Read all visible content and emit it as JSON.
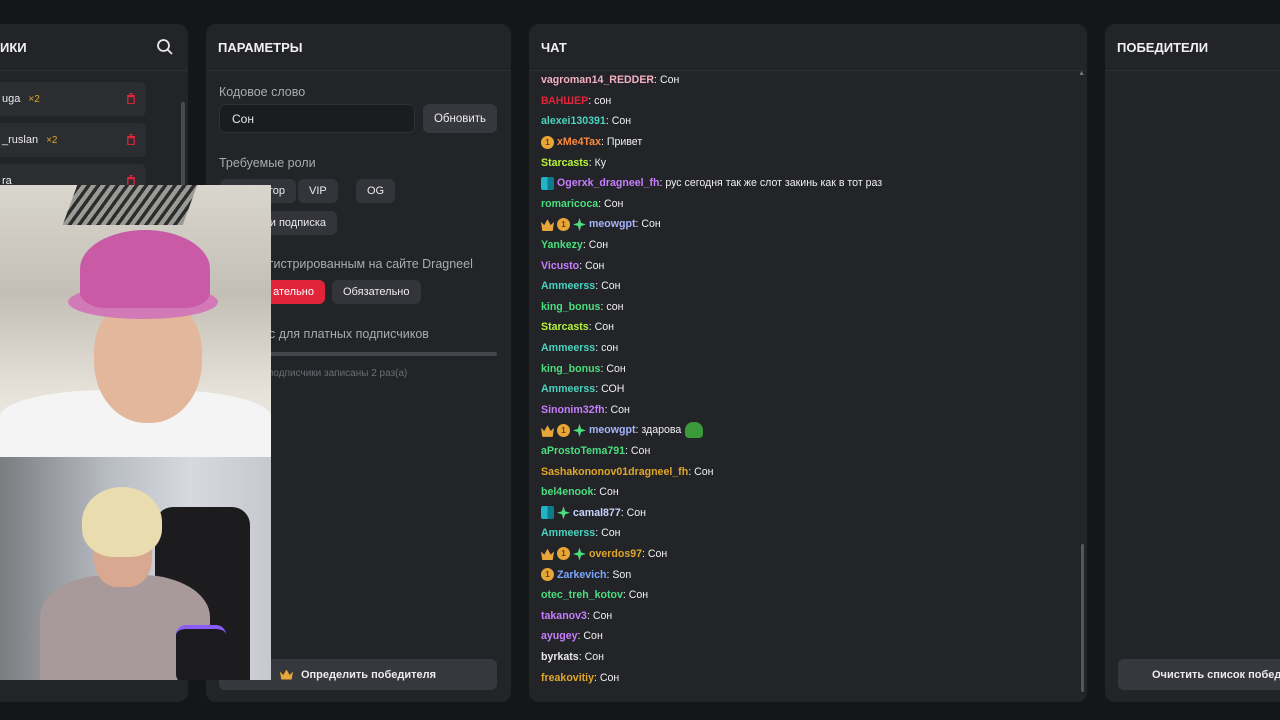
{
  "participants": {
    "title": "ИКИ",
    "items": [
      {
        "name": "uga",
        "count": "×2"
      },
      {
        "name": "_ruslan",
        "count": "×2"
      },
      {
        "name": "ra",
        "count": ""
      }
    ]
  },
  "params": {
    "title": "ПАРАМЕТРЫ",
    "keyword_label": "Кодовое слово",
    "keyword_value": "Сон",
    "refresh_button": "Обновить",
    "roles_label": "Требуемые роли",
    "roles": [
      "тор",
      "VIP",
      "OG",
      "и подписка"
    ],
    "registered_label": "егистрированным на сайте Dragneel",
    "registered_options": [
      "ательно",
      "Обязательно"
    ],
    "bonus_label": "с для платных подписчиков",
    "slider_value": 0.08,
    "bonus_hint": "подписчики записаны 2 раз(а)",
    "winner_button": "Определить победителя"
  },
  "chat": {
    "title": "ЧАТ",
    "messages": [
      {
        "user": "vagroman14_REDDER",
        "color": "#f3b0c3",
        "badges": [],
        "text": "Сон"
      },
      {
        "user": "ВАНШЕР",
        "color": "#e0243a",
        "badges": [],
        "text": "сон"
      },
      {
        "user": "alexei130391",
        "color": "#4ad3c1",
        "badges": [],
        "text": "Сон"
      },
      {
        "user": "xMe4Tax",
        "color": "#ff8a3d",
        "badges": [
          "coin"
        ],
        "text": "Привет"
      },
      {
        "user": "Starcasts",
        "color": "#b6f53a",
        "badges": [],
        "text": "Ку"
      },
      {
        "user": "Ogerxk_dragneel_fh",
        "color": "#c77dff",
        "badges": [
          "app"
        ],
        "text": "рус сегодня так же слот закинь как в тот раз"
      },
      {
        "user": "romaricoca",
        "color": "#4ade80",
        "badges": [],
        "text": "Сон"
      },
      {
        "user": "meowgpt",
        "color": "#a5b4fc",
        "badges": [
          "crown",
          "coin",
          "gem"
        ],
        "text": "Сон"
      },
      {
        "user": "Yankezy",
        "color": "#4ade80",
        "badges": [],
        "text": "Сон"
      },
      {
        "user": "Vicusto",
        "color": "#c77dff",
        "badges": [],
        "text": "Сон"
      },
      {
        "user": "Ammeerss",
        "color": "#4ad3c1",
        "badges": [],
        "text": "Сон"
      },
      {
        "user": "king_bonus",
        "color": "#4ade80",
        "badges": [],
        "text": "сон"
      },
      {
        "user": "Starcasts",
        "color": "#b6f53a",
        "badges": [],
        "text": "Сон"
      },
      {
        "user": "Ammeerss",
        "color": "#4ad3c1",
        "badges": [],
        "text": "сон"
      },
      {
        "user": "king_bonus",
        "color": "#4ade80",
        "badges": [],
        "text": "Сон"
      },
      {
        "user": "Ammeerss",
        "color": "#4ad3c1",
        "badges": [],
        "text": "СОН"
      },
      {
        "user": "Sinonim32fh",
        "color": "#c77dff",
        "badges": [],
        "text": "Сон"
      },
      {
        "user": "meowgpt",
        "color": "#a5b4fc",
        "badges": [
          "crown",
          "coin",
          "gem"
        ],
        "text": "здарова",
        "emote": true
      },
      {
        "user": "aProstoTema791",
        "color": "#4ade80",
        "badges": [],
        "text": "Сон"
      },
      {
        "user": "Sashakononov01dragneel_fh",
        "color": "#e0a72a",
        "badges": [],
        "text": "Сон"
      },
      {
        "user": "bel4enook",
        "color": "#4ade80",
        "badges": [],
        "text": "Сон"
      },
      {
        "user": "camal877",
        "color": "#c8d3ff",
        "badges": [
          "app",
          "gem"
        ],
        "text": "Сон"
      },
      {
        "user": "Ammeerss",
        "color": "#4ad3c1",
        "badges": [],
        "text": "Сон"
      },
      {
        "user": "overdos97",
        "color": "#e0a72a",
        "badges": [
          "crown",
          "coin",
          "gem"
        ],
        "text": "Сон"
      },
      {
        "user": "Zarkevich",
        "color": "#7aa7ff",
        "badges": [
          "coin"
        ],
        "text": "Son"
      },
      {
        "user": "otec_treh_kotov",
        "color": "#4ade80",
        "badges": [],
        "text": "Сон"
      },
      {
        "user": "takanov3",
        "color": "#c77dff",
        "badges": [],
        "text": "Сон"
      },
      {
        "user": "ayugey",
        "color": "#c77dff",
        "badges": [],
        "text": "Сон"
      },
      {
        "user": "byrkats",
        "color": "#e8e8ea",
        "badges": [],
        "text": "Сон"
      },
      {
        "user": "freakovitiy",
        "color": "#e0a72a",
        "badges": [],
        "text": "Сон"
      }
    ]
  },
  "winners": {
    "title": "ПОБЕДИТЕЛИ",
    "clear_button": "Очистить список победи"
  },
  "colors": {
    "accent_red": "#e0243a",
    "panel_bg": "#232427",
    "page_bg": "#151618"
  }
}
